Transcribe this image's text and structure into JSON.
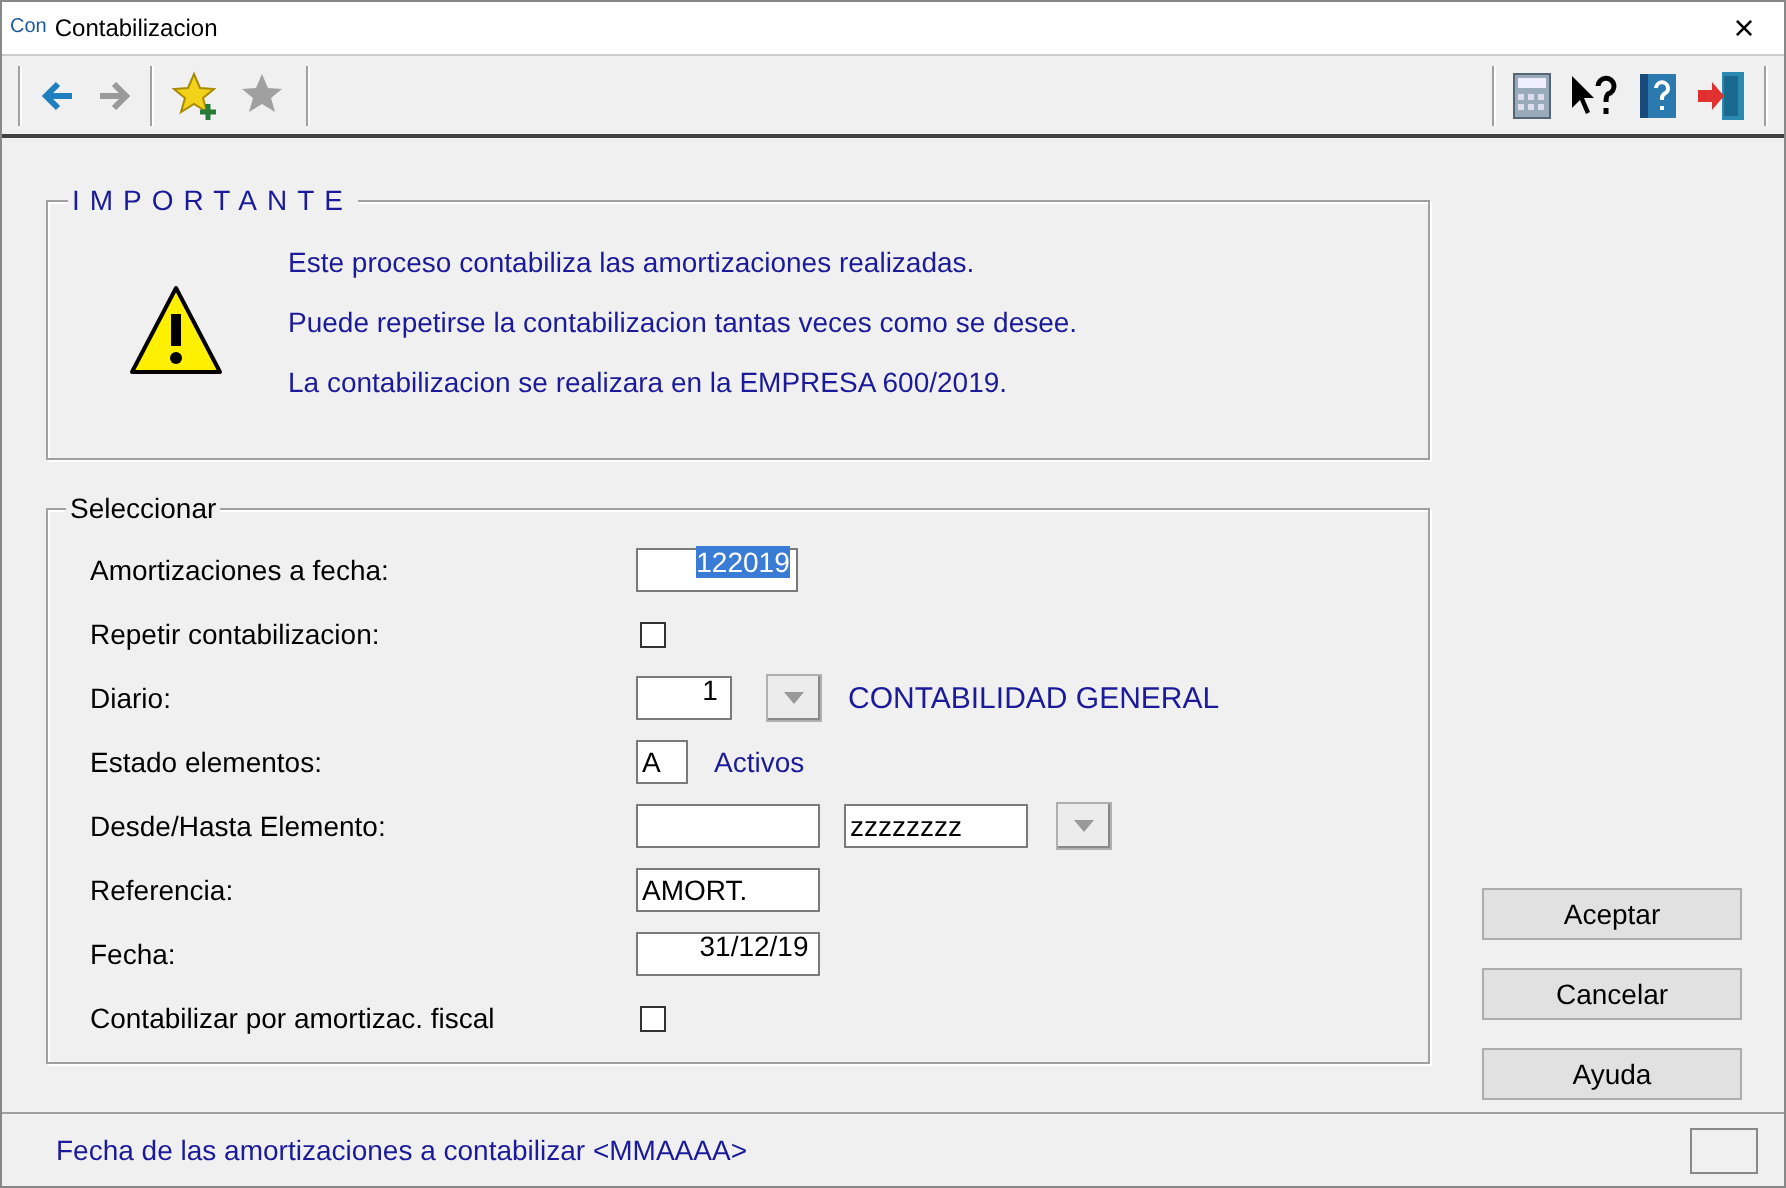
{
  "window": {
    "app_badge": "Con",
    "title": "Contabilizacion",
    "close": "×"
  },
  "toolbar": {
    "left": [
      {
        "kind": "back",
        "disabled": false
      },
      {
        "kind": "forward",
        "disabled": true
      },
      {
        "kind": "star-add",
        "disabled": false
      },
      {
        "kind": "star",
        "disabled": true
      }
    ],
    "right": [
      {
        "kind": "calculator"
      },
      {
        "kind": "help-pointer"
      },
      {
        "kind": "help-book"
      },
      {
        "kind": "exit"
      }
    ]
  },
  "notice": {
    "legend": "IMPORTANTE",
    "lines": [
      "Este proceso contabiliza las amortizaciones realizadas.",
      "Puede repetirse la contabilizacion tantas veces como se desee.",
      "La contabilizacion se realizara en la EMPRESA 600/2019."
    ]
  },
  "form": {
    "legend": "Seleccionar",
    "rows": [
      {
        "label": "Amortizaciones a fecha:",
        "kind": "period",
        "value": "122019",
        "highlighted": true
      },
      {
        "label": "Repetir contabilizacion:",
        "kind": "checkbox",
        "checked": false
      },
      {
        "label": "Diario:",
        "kind": "lookup",
        "value": "1",
        "description": "CONTABILIDAD GENERAL"
      },
      {
        "label": "Estado elementos:",
        "kind": "code",
        "value": "A",
        "description": "Activos"
      },
      {
        "label": "Desde/Hasta Elemento:",
        "kind": "range",
        "to": "zzzzzzzz"
      },
      {
        "label": "Referencia:",
        "kind": "reference",
        "value": "AMORT.",
        "highlighted": false
      },
      {
        "label": "Fecha:",
        "kind": "date",
        "value": "31/12/19",
        "highlighted": false
      },
      {
        "label": "Contabilizar por amortizac. fiscal",
        "kind": "checkbox",
        "checked": false
      }
    ]
  },
  "buttons": [
    "Aceptar",
    "Cancelar",
    "Ayuda"
  ],
  "status_bar": {
    "message": "Fecha de las amortizaciones a contabilizar <MMAAAA>"
  }
}
